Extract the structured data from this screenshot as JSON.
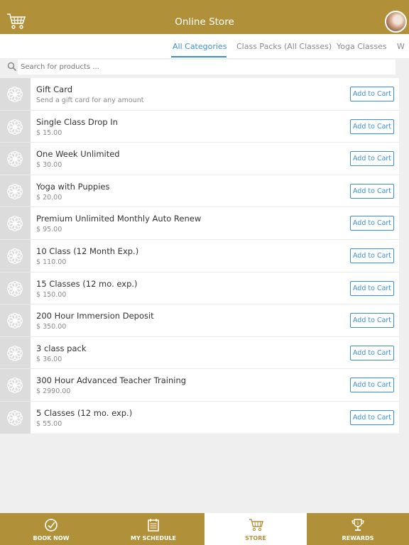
{
  "header": {
    "title": "Online Store",
    "cart_icon": "shopping-cart-icon",
    "avatar": "user-avatar"
  },
  "tabs": [
    {
      "label": "All Categories",
      "active": true
    },
    {
      "label": "Class Packs (All Classes)",
      "active": false
    },
    {
      "label": "Yoga Classes",
      "active": false
    },
    {
      "label": "W",
      "active": false
    }
  ],
  "search": {
    "placeholder": "Search for products ...",
    "value": ""
  },
  "products": [
    {
      "name": "Gift Card",
      "detail": "Send a gift card for any amount",
      "button": "Add to Cart"
    },
    {
      "name": "Single Class Drop In",
      "detail": "$ 15.00",
      "button": "Add to Cart"
    },
    {
      "name": "One Week Unlimited",
      "detail": "$ 30.00",
      "button": "Add to Cart"
    },
    {
      "name": "Yoga with Puppies",
      "detail": "$ 20.00",
      "button": "Add to Cart"
    },
    {
      "name": "Premium Unlimited Monthly Auto Renew",
      "detail": "$ 95.00",
      "button": "Add to Cart"
    },
    {
      "name": "10 Class (12 Month Exp.)",
      "detail": "$ 110.00",
      "button": "Add to Cart"
    },
    {
      "name": "15 Classes (12 mo. exp.)",
      "detail": "$ 150.00",
      "button": "Add to Cart"
    },
    {
      "name": "200 Hour Immersion Deposit",
      "detail": "$ 350.00",
      "button": "Add to Cart"
    },
    {
      "name": "3 class pack",
      "detail": "$ 36.00",
      "button": "Add to Cart"
    },
    {
      "name": "300 Hour Advanced Teacher Training",
      "detail": "$ 2990.00",
      "button": "Add to Cart"
    },
    {
      "name": "5 Classes (12 mo. exp.)",
      "detail": "$ 55.00",
      "button": "Add to Cart"
    }
  ],
  "footer": [
    {
      "label": "BOOK NOW",
      "icon": "check-circle-icon",
      "active": false
    },
    {
      "label": "MY SCHEDULE",
      "icon": "calendar-icon",
      "active": false
    },
    {
      "label": "STORE",
      "icon": "shopping-cart-icon",
      "active": true
    },
    {
      "label": "REWARDS",
      "icon": "trophy-icon",
      "active": false
    }
  ],
  "colors": {
    "brand": "#b0913a",
    "accent": "#3b8fd7",
    "background": "#efefef"
  }
}
